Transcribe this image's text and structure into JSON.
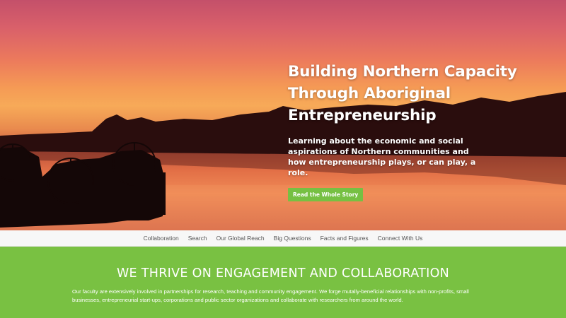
{
  "hero": {
    "headline": [
      "Building Northern Capacity",
      "Through Aboriginal",
      "Entrepreneurship"
    ],
    "subtext": "Learning about the economic and social aspirations of Northern communities and how entrepreneurship plays, or can play, a role.",
    "cta_label": "Read the Whole Story"
  },
  "nav": {
    "items": [
      "Collaboration",
      "Search",
      "Our Global Reach",
      "Big Questions",
      "Facts and Figures",
      "Connect With Us"
    ]
  },
  "engagement": {
    "heading": "WE THRIVE ON ENGAGEMENT AND COLLABORATION",
    "body": "Our faculty are extensively involved in partnerships for research, teaching and community engagement.  We forge mutally-beneficial relationships with non-profits, small businesses, entrepreneurial start-ups, corporations and public sector organizations and collaborate with researchers from around the world."
  },
  "colors": {
    "accent_green": "#79c142",
    "button_green": "#76c043"
  }
}
